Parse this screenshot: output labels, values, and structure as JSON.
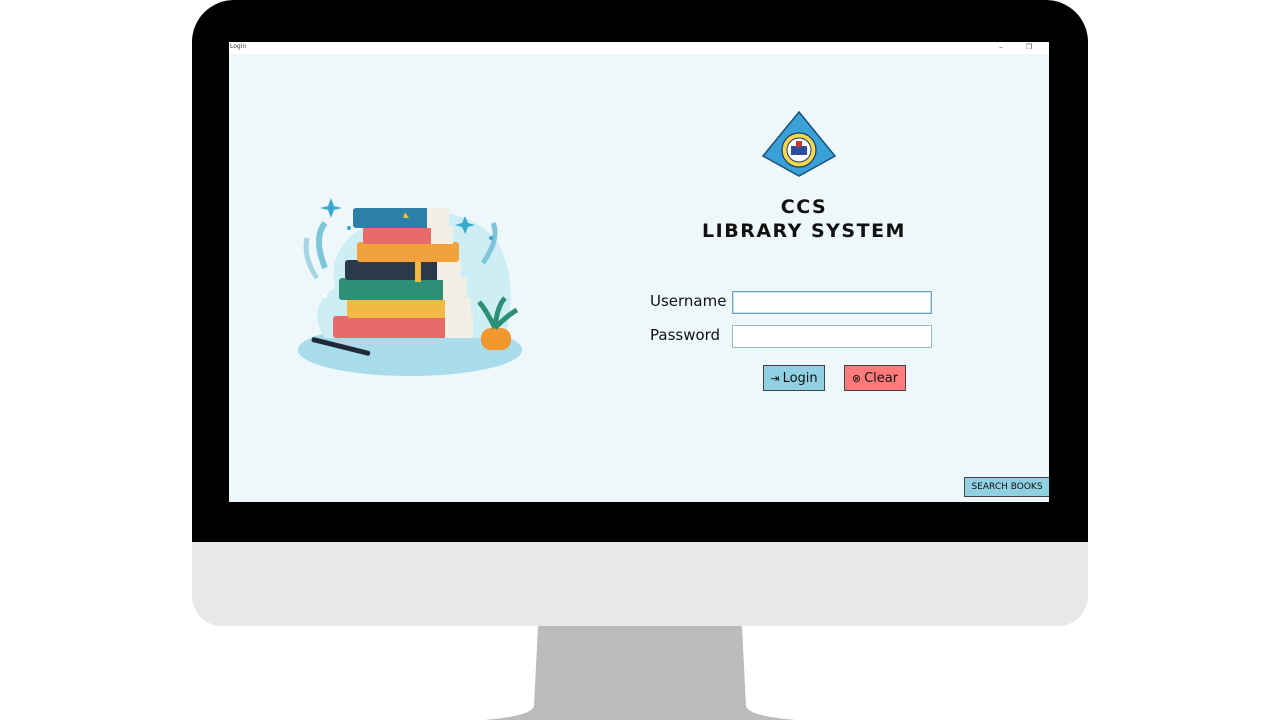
{
  "window": {
    "title": "Login",
    "minimize_icon": "minimize-icon",
    "restore_icon": "restore-icon"
  },
  "app": {
    "title_line1": "CCS",
    "title_line2": "LIBRARY SYSTEM"
  },
  "form": {
    "username_label": "Username",
    "password_label": "Password",
    "username_value": "",
    "password_value": ""
  },
  "buttons": {
    "login_label": "Login",
    "login_icon": "login-arrow-icon",
    "clear_label": "Clear",
    "clear_icon": "circle-x-icon",
    "search_books_label": "SEARCH BOOKS"
  },
  "colors": {
    "screen_bg": "#eef8fa",
    "login_button": "#8fd0e2",
    "clear_button": "#ff7b7b",
    "search_button": "#8fd0e2",
    "bezel": "#000000",
    "chin": "#e8e8e8",
    "stand": "#bcbcbc"
  }
}
